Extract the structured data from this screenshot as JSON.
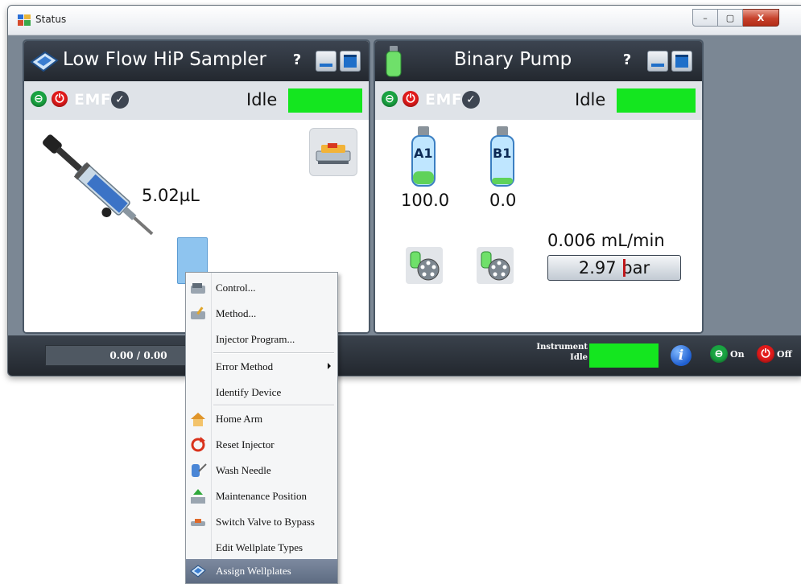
{
  "window": {
    "title": "Status",
    "controls": {
      "minimize": "–",
      "restore": "▢",
      "close": "X"
    }
  },
  "sampler": {
    "title": "Low Flow HiP Sampler",
    "help": "?",
    "emf": "EMF",
    "status": "Idle",
    "status_color": "#14e61f",
    "volume": "5.02µL"
  },
  "pump": {
    "title": "Binary Pump",
    "help": "?",
    "emf": "EMF",
    "status": "Idle",
    "status_color": "#14e61f",
    "bottles": [
      {
        "label": "A1",
        "value": "100.0"
      },
      {
        "label": "B1",
        "value": "0.0"
      }
    ],
    "flow": "0.006 mL/min",
    "pressure": "2.97 bar"
  },
  "bottom": {
    "progress": "0.00 / 0.00",
    "instrument_line1": "Instrument",
    "instrument_line2": "Idle",
    "instrument_color": "#14e61f",
    "on_label": "On",
    "off_label": "Off"
  },
  "menu": {
    "items": [
      {
        "label": "Control...",
        "icon": "sampler-control-icon"
      },
      {
        "label": "Method...",
        "icon": "method-icon"
      },
      {
        "label": "Injector Program...",
        "icon": ""
      },
      {
        "label": "Error Method",
        "icon": "",
        "submenu": true
      },
      {
        "label": "Identify Device",
        "icon": ""
      },
      {
        "label": "Home Arm",
        "icon": "home-icon"
      },
      {
        "label": "Reset Injector",
        "icon": "reset-icon"
      },
      {
        "label": "Wash Needle",
        "icon": "wash-needle-icon"
      },
      {
        "label": "Maintenance Position",
        "icon": "maintenance-icon"
      },
      {
        "label": "Switch Valve to Bypass",
        "icon": "bypass-icon"
      },
      {
        "label": "Edit Wellplate Types",
        "icon": ""
      },
      {
        "label": "Assign Wellplates",
        "icon": "assign-wellplates-icon",
        "selected": true
      }
    ]
  }
}
